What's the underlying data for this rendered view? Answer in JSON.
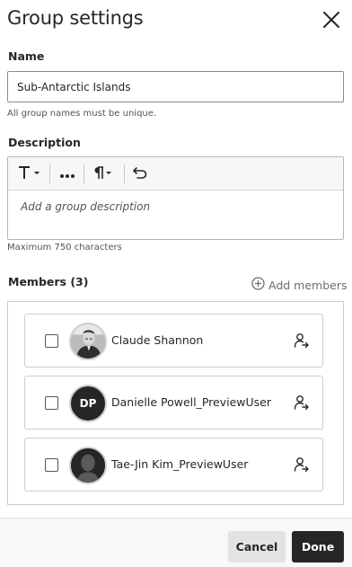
{
  "dialog": {
    "title": "Group settings",
    "close_icon": "close-icon"
  },
  "name_field": {
    "label": "Name",
    "value": "Sub-Antarctic Islands",
    "hint": "All group names must be unique."
  },
  "description_field": {
    "label": "Description",
    "placeholder": "Add a group description",
    "hint": "Maximum 750 characters",
    "toolbar": [
      {
        "name": "text-style",
        "icon": "text-format-icon",
        "has_dropdown": true
      },
      {
        "name": "more-formatting",
        "icon": "ellipsis-icon",
        "has_dropdown": false
      },
      {
        "name": "paragraph",
        "icon": "paragraph-icon",
        "has_dropdown": true
      },
      {
        "name": "undo",
        "icon": "undo-icon",
        "has_dropdown": false
      }
    ]
  },
  "members": {
    "label": "Members (3)",
    "add_label": "Add members",
    "list": [
      {
        "name": "Claude Shannon",
        "avatar_type": "photo",
        "initials": "",
        "checked": false
      },
      {
        "name": "Danielle Powell_PreviewUser",
        "avatar_type": "initials",
        "initials": "DP",
        "checked": false
      },
      {
        "name": "Tae-Jin Kim_PreviewUser",
        "avatar_type": "silhouette",
        "initials": "",
        "checked": false
      }
    ]
  },
  "footer": {
    "cancel_label": "Cancel",
    "done_label": "Done"
  },
  "colors": {
    "text": "#262626",
    "muted": "#545454",
    "border": "#cdcdcd",
    "done_bg": "#262626",
    "cancel_bg": "#e3e3e3"
  }
}
